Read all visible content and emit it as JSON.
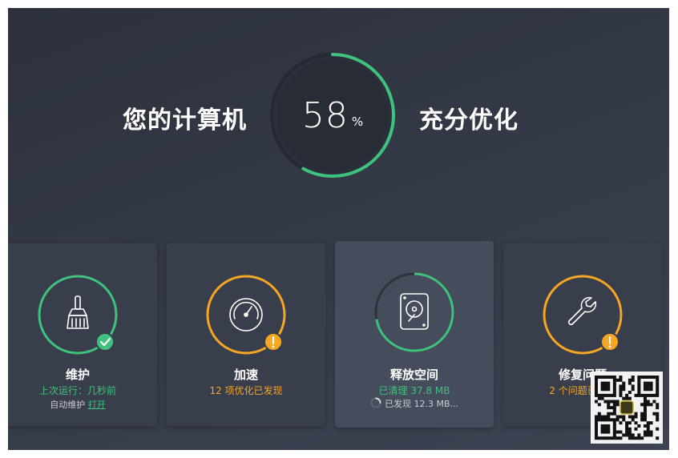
{
  "hero": {
    "left_text": "您的计算机",
    "right_text": "充分优化",
    "score": "58",
    "unit": "%",
    "progress": 0.58
  },
  "colors": {
    "green": "#3fc27d",
    "orange": "#f5a623",
    "background": "#333946",
    "card": "#383e4b"
  },
  "cards": [
    {
      "title": "维护",
      "status": "上次运行：几秒前",
      "sub_prefix": "自动维护",
      "sub_link": "打开",
      "icon": "broom-icon",
      "badge": "check-badge-icon"
    },
    {
      "title": "加速",
      "status": "12 项优化已发现",
      "icon": "speedometer-icon",
      "badge": "warning-badge-icon"
    },
    {
      "title": "释放空间",
      "status": "已清理 37.8 MB",
      "sub": "已发现 12.3 MB...",
      "icon": "hard-drive-icon",
      "badge": "",
      "progress": 0.72
    },
    {
      "title": "修复问题",
      "status": "2 个问题已发现",
      "icon": "wrench-icon",
      "badge": "warning-badge-icon"
    }
  ],
  "overlay": {
    "icon": "qr-code-icon"
  }
}
